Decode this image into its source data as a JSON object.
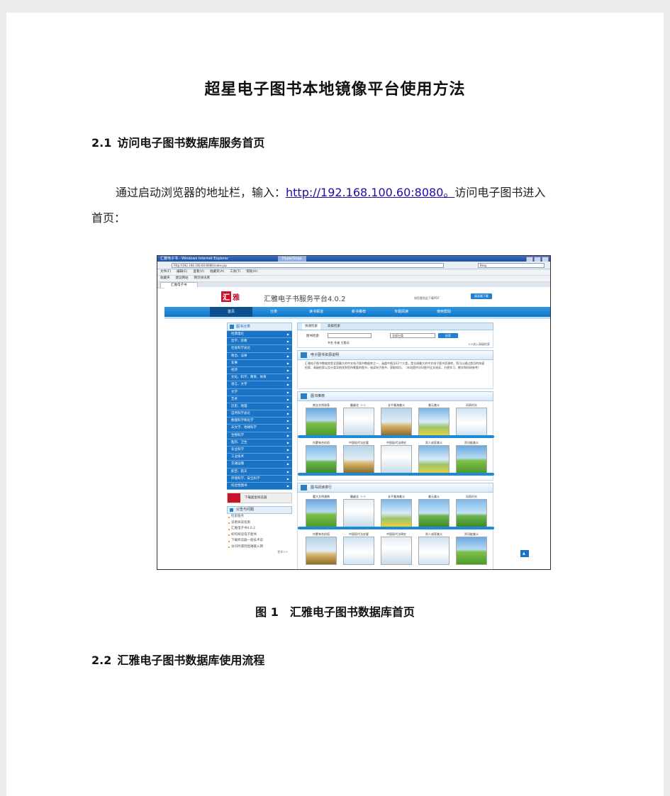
{
  "document": {
    "title": "超星电子图书本地镜像平台使用方法",
    "section1": {
      "number": "2.1",
      "heading": "访问电子图书数据库服务首页"
    },
    "para": {
      "before_link": "通过启动浏览器的地址栏，输入：",
      "link": "http://192.168.100.60:8080。",
      "after_link": "访问电子图书进入",
      "line2": "首页："
    },
    "figure_caption": {
      "number": "图 1",
      "text": "汇雅电子图书数据库首页"
    },
    "section2": {
      "number": "2.2",
      "heading": "汇雅电子图书数据库使用流程"
    }
  },
  "screenshot": {
    "window_title": "汇雅电子书 - Windows Internet Explorer",
    "capture_tab": "HyperSnap",
    "address": "http://192.168.100.60:8080/index.jsp",
    "search_box": "Bing",
    "menu": [
      "文件(F)",
      "编辑(E)",
      "查看(V)",
      "收藏夹(A)",
      "工具(T)",
      "帮助(H)"
    ],
    "favorites": [
      "收藏夹",
      "建议网站",
      "网页快讯库"
    ],
    "tab": "汇雅电子书",
    "site": {
      "logo_mark": "汇",
      "logo_text": "雅",
      "platform": "汇雅电子书服务平台4.0.2",
      "head_note": "如您看到此下载PDF",
      "head_button": "阅读器下载",
      "nav": [
        "首页",
        "分类",
        "读书频道",
        "新书推荐",
        "专题阅读",
        "使用帮助"
      ],
      "categories_title": "图书分类",
      "categories": [
        "经典理论",
        "哲学、宗教",
        "社会科学总论",
        "政治、法律",
        "军事",
        "经济",
        "文化、科学、教育、体育",
        "语言、文字",
        "文学",
        "艺术",
        "历史、地理",
        "自然科学总论",
        "数理科学和化学",
        "天文学、地球科学",
        "生物科学",
        "医药、卫生",
        "农业科学",
        "工业技术",
        "交通运输",
        "航空、航天",
        "环境科学、安全科学",
        "综合性图书"
      ],
      "banner": "下载超星阅览器",
      "faq_title": "公告与问题",
      "faq": [
        "检索服务",
        "读者阅读指南",
        "汇雅电子书4.0.2",
        "如何阅读电子图书",
        "下载阅读器一般技术说",
        "访问时遇到困难输入网"
      ],
      "faq_more": "更多>>",
      "search_tabs": [
        "快速检索",
        "高级检索"
      ],
      "search_label": "图书检索",
      "search_select": "全部分类",
      "search_button": "检索",
      "search_radios": "书名  作者  主题词",
      "search_adv": ">>进入高级检索",
      "intro_title": "电子图书资源说明",
      "intro_text": "汇雅电子图书数据库是全国最大的中文电子图书数据库之一，涵盖中图法22个大类，是全球最大的中文电子图书资源库。您可以通过首页的快速检索、高级检索以及分类导航找到您所需要的图书，阅读电子图书，获取知识。（本站提供访问图书全文阅读，方便学习、教学和科研参考）",
      "rec_title": "图书推荐",
      "rec_row1": [
        "商业文明改革",
        "翻越北（一）",
        "长平美海美义",
        "美元美义",
        "风雨时光"
      ],
      "rec_row2": [
        "内蒙林合伯塔",
        "中国现代法史要",
        "中国现代法律史",
        "男人成家美义",
        "资讯能美义"
      ],
      "rank_title": "图书阅读排行",
      "rank_row1": [
        "重大文明通典",
        "翻越北（一）",
        "长平美海美义",
        "美元美义",
        "风雨时光"
      ],
      "rank_row2": [
        "内蒙林合伯塔",
        "中国现代法史要",
        "中国现代法律史",
        "男人成家美义",
        "资讯能美义"
      ]
    }
  }
}
